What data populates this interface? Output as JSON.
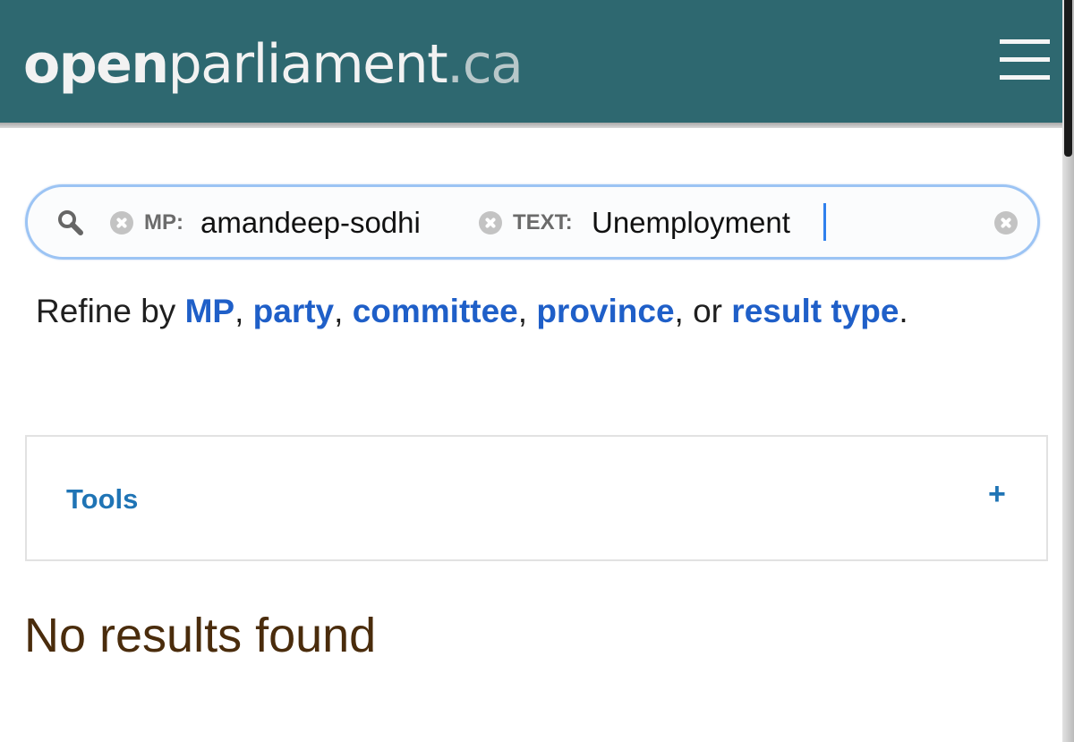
{
  "header": {
    "logo_open": "open",
    "logo_parliament": "parliament",
    "logo_ca": ".ca",
    "menu_icon": "hamburger-menu-icon",
    "background_color": "#2e6870"
  },
  "search": {
    "icon": "search-icon",
    "tokens": [
      {
        "key": "MP:",
        "value": "amandeep-sodhi"
      },
      {
        "key": "TEXT:",
        "value": "Unemployment"
      }
    ],
    "clear_icon": "clear-icon"
  },
  "refine": {
    "prefix": "Refine by ",
    "link_mp": "MP",
    "sep1": ", ",
    "link_party": "party",
    "sep2": ", ",
    "link_committee": "committee",
    "sep3": ", ",
    "link_province": "province",
    "sep4": ", or ",
    "link_result_type": "result type",
    "suffix": "."
  },
  "tools": {
    "label": "Tools",
    "expand": "+"
  },
  "results": {
    "empty_message": "No results found"
  }
}
